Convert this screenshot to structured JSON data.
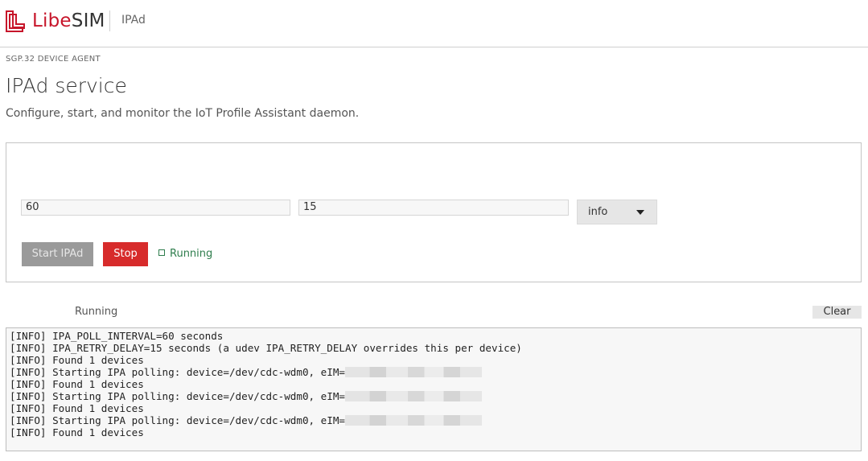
{
  "header": {
    "brand_libe": "Libe",
    "brand_sim": "SIM",
    "app_name": "IPAd"
  },
  "page": {
    "eyebrow": "SGP.32 DEVICE AGENT",
    "title": "IPAd service",
    "subtitle": "Configure, start, and monitor the IoT Profile Assistant daemon."
  },
  "config": {
    "poll_interval_value": "60",
    "retry_delay_value": "15",
    "log_level_selected": "info",
    "start_label": "Start IPAd",
    "stop_label": "Stop",
    "status_label": "Running"
  },
  "log": {
    "status_label": "Running",
    "clear_label": "Clear",
    "lines": [
      {
        "text": "[INFO] IPA_POLL_INTERVAL=60 seconds",
        "redacted": false
      },
      {
        "text": "[INFO] IPA_RETRY_DELAY=15 seconds (a udev IPA_RETRY_DELAY overrides this per device)",
        "redacted": false
      },
      {
        "text": "[INFO] Found 1 devices",
        "redacted": false
      },
      {
        "text": "[INFO] Starting IPA polling: device=/dev/cdc-wdm0, eIM=",
        "redacted": true
      },
      {
        "text": "[INFO] Found 1 devices",
        "redacted": false
      },
      {
        "text": "[INFO] Starting IPA polling: device=/dev/cdc-wdm0, eIM=",
        "redacted": true
      },
      {
        "text": "[INFO] Found 1 devices",
        "redacted": false
      },
      {
        "text": "[INFO] Starting IPA polling: device=/dev/cdc-wdm0, eIM=",
        "redacted": true
      },
      {
        "text": "[INFO] Found 1 devices",
        "redacted": false
      }
    ]
  },
  "colors": {
    "brand_red": "#c7162b",
    "stop_red": "#d72b2b",
    "running_green": "#2e7d4c"
  }
}
